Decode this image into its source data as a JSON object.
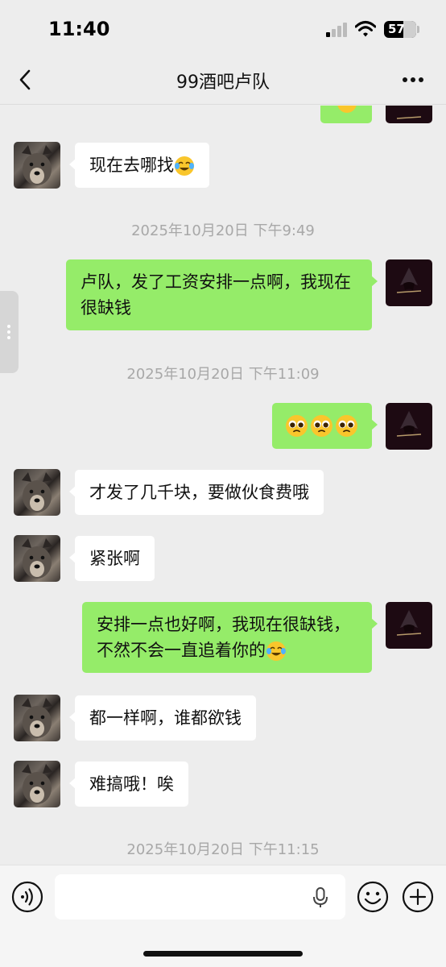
{
  "status_bar": {
    "time": "11:40",
    "battery": "57"
  },
  "nav": {
    "title": "99酒吧卢队"
  },
  "messages": {
    "m1": "现在去哪找",
    "ts1": "2025年10月20日 下午9:49",
    "m2": "卢队，发了工资安排一点啊，我现在很缺钱",
    "ts2": "2025年10月20日 下午11:09",
    "m4": "才发了几千块，要做伙食费哦",
    "m5": "紧张啊",
    "m6": "安排一点也好啊，我现在很缺钱，不然不会一直追着你的",
    "m7": "都一样啊，谁都欲钱",
    "m8": "难搞哦！唉",
    "ts3": "2025年10月20日 下午11:15"
  },
  "colors": {
    "outgoing_bubble": "#95ec69",
    "incoming_bubble": "#ffffff",
    "background": "#ededed"
  }
}
